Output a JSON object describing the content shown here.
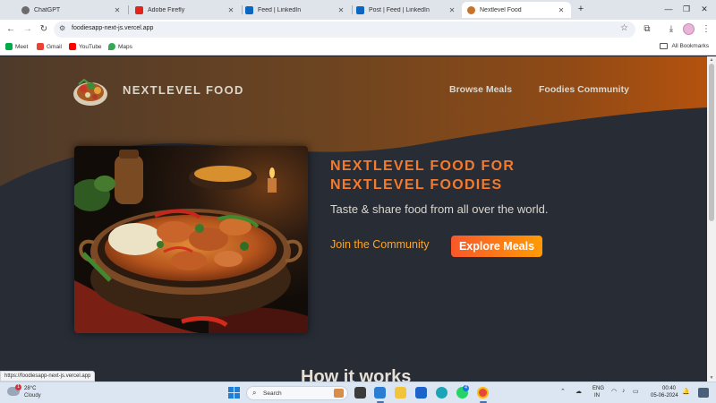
{
  "browser": {
    "tabs": [
      {
        "title": "ChatGPT",
        "icon": "chatgpt-icon",
        "color": "#6b6b6b",
        "active": false
      },
      {
        "title": "Adobe Firefly",
        "icon": "adobe-firefly-icon",
        "color": "#e1251b",
        "active": false
      },
      {
        "title": "Feed | LinkedIn",
        "icon": "linkedin-icon",
        "color": "#0a66c2",
        "active": false
      },
      {
        "title": "Post | Feed | LinkedIn",
        "icon": "linkedin-icon",
        "color": "#0a66c2",
        "active": false
      },
      {
        "title": "Nextlevel Food",
        "icon": "food-favicon",
        "color": "#c8732a",
        "active": true
      }
    ],
    "url": "foodiesapp-next-js.vercel.app",
    "bookmarks": [
      {
        "label": "Meet",
        "icon": "google-meet-icon",
        "color": "#00ac47"
      },
      {
        "label": "Gmail",
        "icon": "gmail-icon",
        "color": "#ea4335"
      },
      {
        "label": "YouTube",
        "icon": "youtube-icon",
        "color": "#ff0000"
      },
      {
        "label": "Maps",
        "icon": "google-maps-icon",
        "color": "#34a853"
      }
    ],
    "all_bookmarks_label": "All Bookmarks",
    "status_url": "https://foodiesapp-next-js.vercel.app"
  },
  "page": {
    "brand": "NEXTLEVEL FOOD",
    "nav": [
      "Browse Meals",
      "Foodies Community"
    ],
    "headline_line1": "NEXTLEVEL FOOD FOR",
    "headline_line2": "NEXTLEVEL FOODIES",
    "tagline": "Taste & share food from all over the world.",
    "join_label": "Join the Community",
    "explore_label": "Explore Meals",
    "section_title": "How it works",
    "colors": {
      "accent": "#f47a2d",
      "link": "#f9a52a",
      "button_from": "#f9572a",
      "button_to": "#ff9b05",
      "background": "#282c35"
    }
  },
  "taskbar": {
    "temperature": "28°C",
    "weather": "Cloudy",
    "weather_badge": "1",
    "search_label": "Search",
    "whatsapp_badge": "4",
    "language": "ENG",
    "region": "IN",
    "time": "00:40",
    "date": "05-06-2024"
  }
}
